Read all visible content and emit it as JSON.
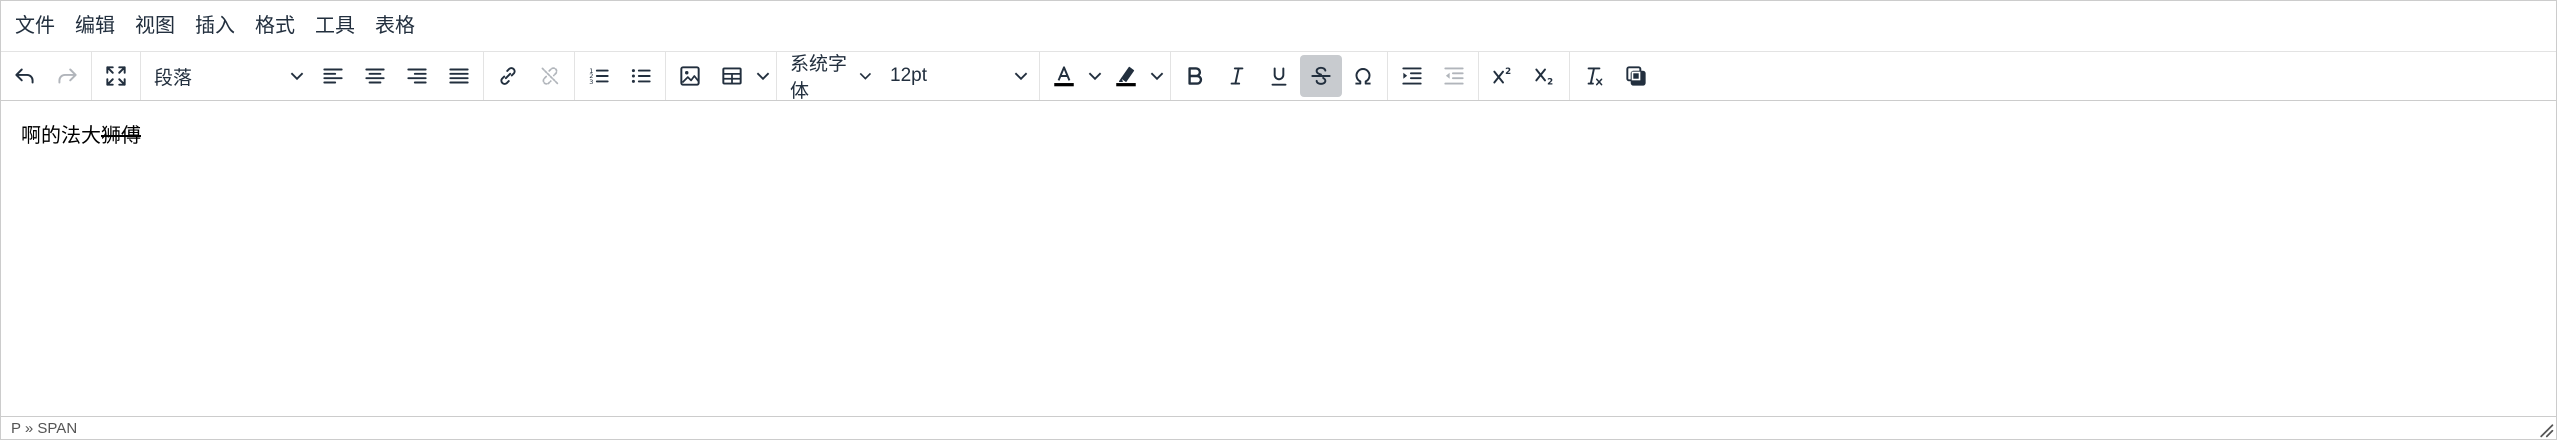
{
  "menubar": {
    "items": [
      "文件",
      "编辑",
      "视图",
      "插入",
      "格式",
      "工具",
      "表格"
    ]
  },
  "toolbar": {
    "block_format": "段落",
    "font_family": "系统字体",
    "font_size": "12pt",
    "text_color": "#000000",
    "highlight_color": "#000000",
    "active_color": "#c8cbcf",
    "buttons": {
      "undo": "undo-icon",
      "redo": "redo-icon",
      "fullscreen": "fullscreen-icon",
      "align_left": "align-left-icon",
      "align_center": "align-center-icon",
      "align_right": "align-right-icon",
      "align_justify": "align-justify-icon",
      "link": "link-icon",
      "unlink": "unlink-icon",
      "numbered_list": "numbered-list-icon",
      "bullet_list": "bullet-list-icon",
      "image": "image-icon",
      "table": "table-icon",
      "bold": "B",
      "italic": "I",
      "underline": "U",
      "strikethrough": "S",
      "special_char": "Ω",
      "indent": "indent-icon",
      "outdent": "outdent-icon",
      "superscript": "superscript-icon",
      "subscript": "subscript-icon",
      "remove_format": "remove-format-icon",
      "copy_format": "copy-format-icon"
    }
  },
  "content": {
    "plain_text": "啊的法大",
    "strike_text": "狮傅"
  },
  "statusbar": {
    "path": "P » SPAN"
  }
}
